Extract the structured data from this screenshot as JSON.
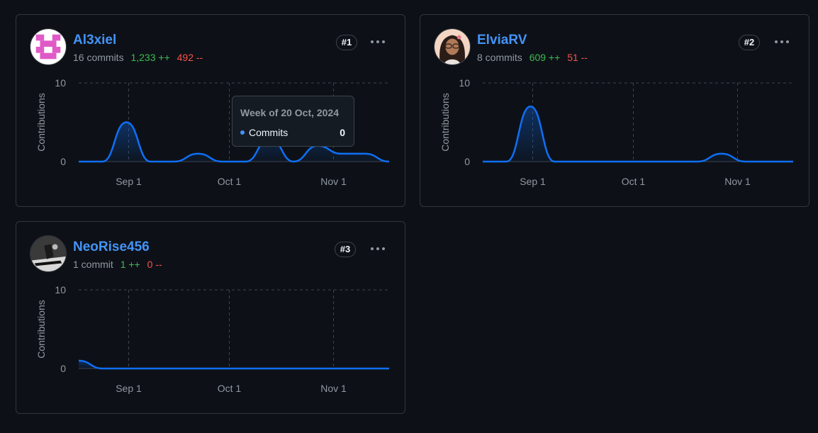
{
  "colors": {
    "accent": "#4493f8",
    "line": "#0f6ff5",
    "additions": "#3fb950",
    "deletions": "#f85149",
    "grid": "#3d444d"
  },
  "contributors": [
    {
      "username": "Al3xiel",
      "commits": "16 commits",
      "additions": "1,233 ++",
      "deletions": "492 --",
      "rank": "#1",
      "menu_icon": "kebab-horizontal-icon",
      "avatar_icon": "pink-identicon-avatar",
      "chart_data": {
        "type": "area",
        "x": [
          "Aug 18",
          "Aug 25",
          "Sep 1",
          "Sep 8",
          "Sep 15",
          "Sep 22",
          "Sep 29",
          "Oct 6",
          "Oct 13",
          "Oct 20",
          "Oct 27",
          "Nov 3",
          "Nov 10",
          "Nov 17"
        ],
        "series": [
          {
            "values": [
              0,
              0,
              5,
              0,
              0,
              1,
              0,
              0,
              3,
              0,
              2,
              1,
              1,
              0
            ]
          }
        ],
        "ylabel": "Contributions",
        "yticks": [
          "0",
          "10"
        ],
        "ylim": [
          0,
          10
        ],
        "xticks": [
          "Sep 1",
          "Oct 1",
          "Nov 1"
        ],
        "grid": true
      },
      "tooltip": {
        "title": "Week of 20 Oct, 2024",
        "label": "Commits",
        "value": "0"
      }
    },
    {
      "username": "ElviaRV",
      "commits": "8 commits",
      "additions": "609 ++",
      "deletions": "51 --",
      "rank": "#2",
      "menu_icon": "kebab-horizontal-icon",
      "avatar_icon": "portrait-avatar",
      "chart_data": {
        "type": "area",
        "x": [
          "Aug 18",
          "Aug 25",
          "Sep 1",
          "Sep 8",
          "Sep 15",
          "Sep 22",
          "Sep 29",
          "Oct 6",
          "Oct 13",
          "Oct 20",
          "Oct 27",
          "Nov 3",
          "Nov 10",
          "Nov 17"
        ],
        "series": [
          {
            "values": [
              0,
              0,
              7,
              0,
              0,
              0,
              0,
              0,
              0,
              0,
              1,
              0,
              0,
              0
            ]
          }
        ],
        "ylabel": "Contributions",
        "yticks": [
          "0",
          "10"
        ],
        "ylim": [
          0,
          10
        ],
        "xticks": [
          "Sep 1",
          "Oct 1",
          "Nov 1"
        ],
        "grid": true
      }
    },
    {
      "username": "NeoRise456",
      "commits": "1 commit",
      "additions": "1 ++",
      "deletions": "0 --",
      "rank": "#3",
      "menu_icon": "kebab-horizontal-icon",
      "avatar_icon": "photo-avatar",
      "chart_data": {
        "type": "area",
        "x": [
          "Aug 18",
          "Aug 25",
          "Sep 1",
          "Sep 8",
          "Sep 15",
          "Sep 22",
          "Sep 29",
          "Oct 6",
          "Oct 13",
          "Oct 20",
          "Oct 27",
          "Nov 3",
          "Nov 10",
          "Nov 17"
        ],
        "series": [
          {
            "values": [
              1,
              0,
              0,
              0,
              0,
              0,
              0,
              0,
              0,
              0,
              0,
              0,
              0,
              0
            ]
          }
        ],
        "ylabel": "Contributions",
        "yticks": [
          "0",
          "10"
        ],
        "ylim": [
          0,
          10
        ],
        "xticks": [
          "Sep 1",
          "Oct 1",
          "Nov 1"
        ],
        "grid": true
      }
    }
  ]
}
